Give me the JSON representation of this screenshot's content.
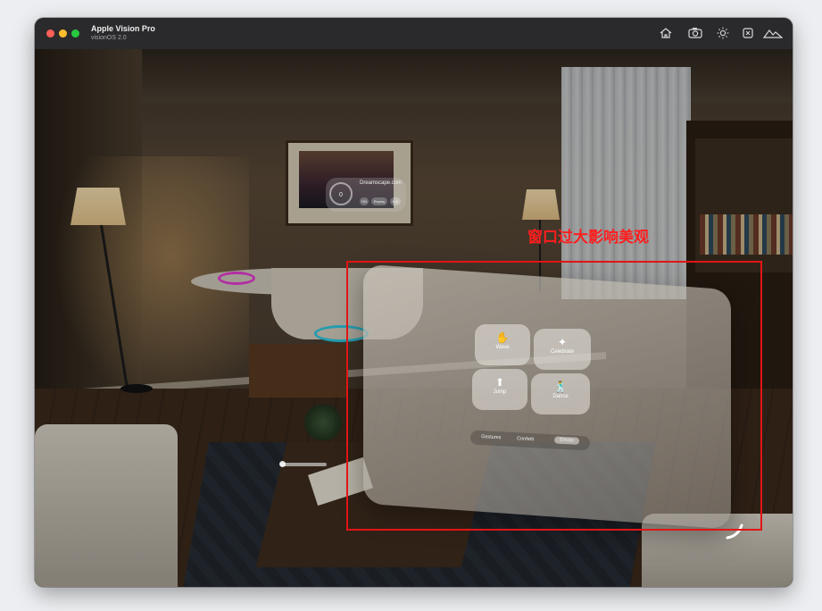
{
  "window": {
    "title": "Apple Vision Pro",
    "subtitle": "visionOS 2.0",
    "toolbar_icons": [
      "home-icon",
      "camera-icon",
      "brightness-icon",
      "capture-icon",
      "environment-icon"
    ]
  },
  "background_panel": {
    "ring_value": "0",
    "title": "Dreamscape.com",
    "buttons": [
      "ON",
      "Replay",
      "Exit"
    ]
  },
  "app_window": {
    "actions": [
      {
        "label": "Wave",
        "icon": "wave-hand-icon"
      },
      {
        "label": "Celebrate",
        "icon": "party-popper-icon"
      },
      {
        "label": "Jump",
        "icon": "arrow-up-icon"
      },
      {
        "label": "Dance",
        "icon": "dancer-icon"
      }
    ],
    "segments": [
      "Gestures",
      "Confetti",
      "Emote"
    ],
    "selected_segment": "Emote"
  },
  "annotation": {
    "text": "窗口过大影响美观",
    "color": "#e21515"
  },
  "colors": {
    "close": "#fe5f57",
    "minimize": "#febc2e",
    "zoom": "#28c840"
  }
}
